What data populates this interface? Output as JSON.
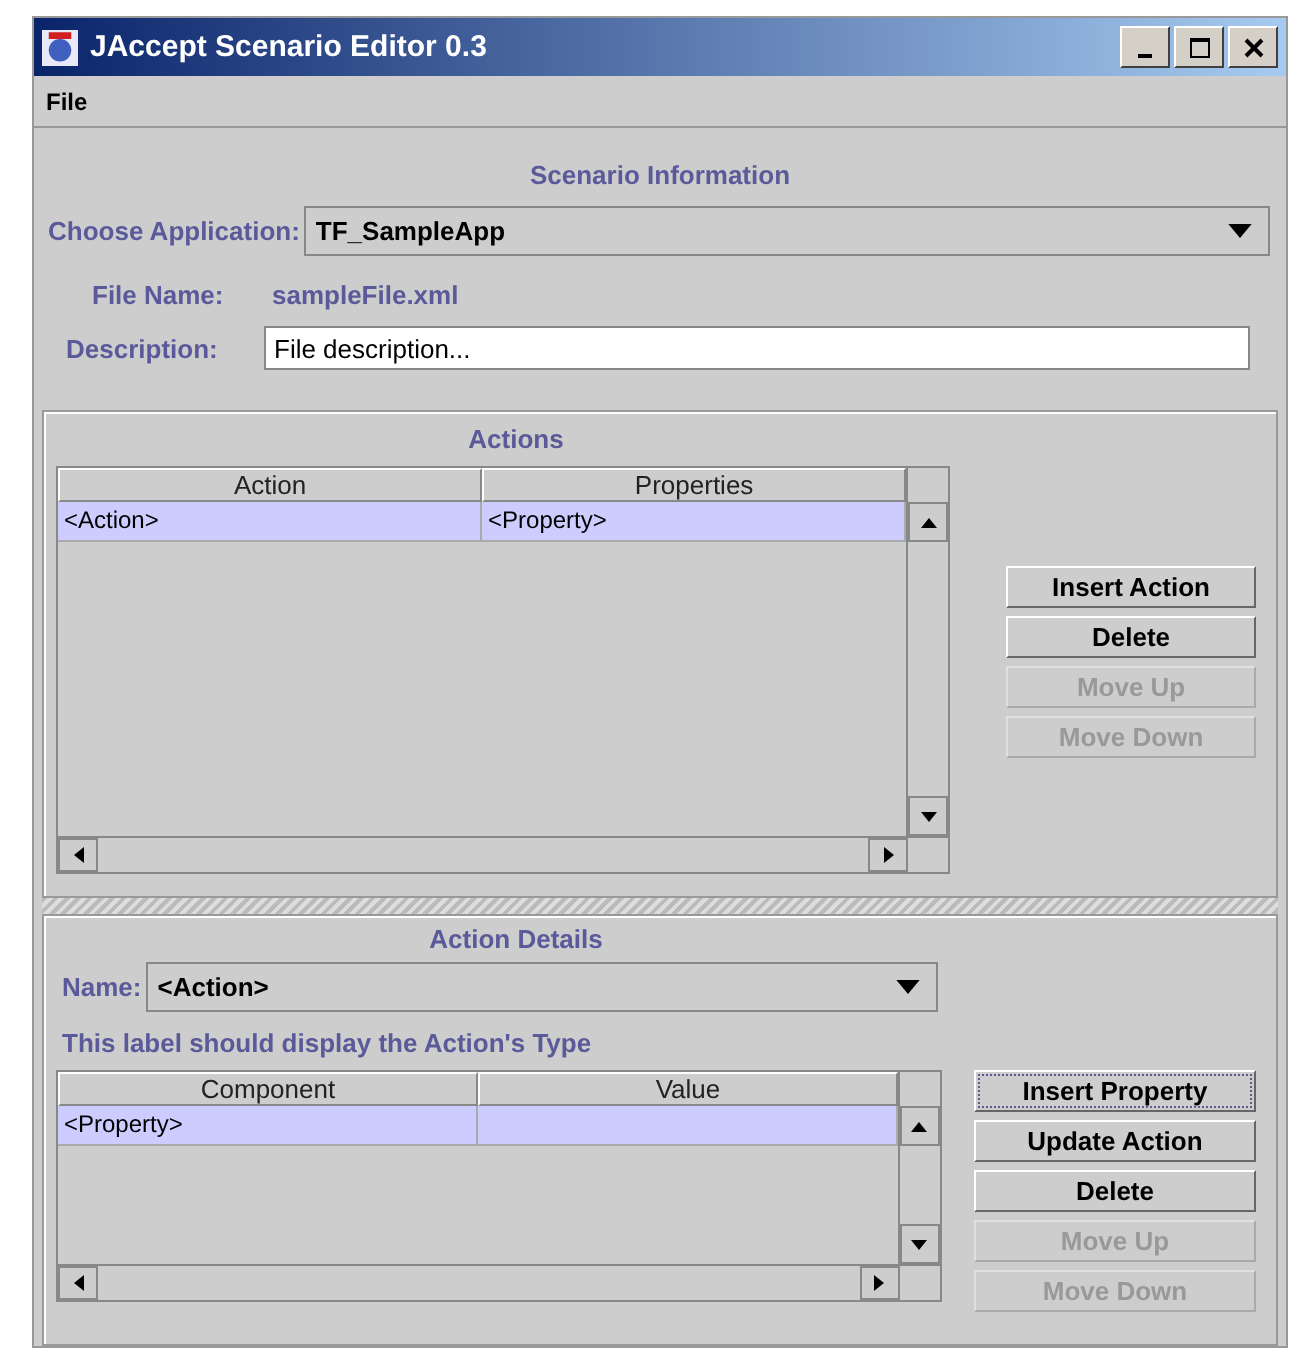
{
  "window": {
    "title": "JAccept Scenario Editor 0.3"
  },
  "menu": [
    {
      "label": "File"
    }
  ],
  "scenario": {
    "heading": "Scenario Information",
    "application_label": "Choose Application:",
    "application": "TF_SampleApp",
    "file_name_label": "File Name:",
    "file_name": "sampleFile.xml",
    "description_label": "Description:",
    "description": "File description..."
  },
  "actions": {
    "heading": "Actions",
    "columns": [
      "Action",
      "Properties"
    ],
    "rows": [
      {
        "cells": [
          "<Action>",
          "<Property>"
        ],
        "selected": true
      }
    ],
    "buttons": [
      {
        "label": "Insert Action",
        "disabled": false,
        "focused": false
      },
      {
        "label": "Delete",
        "disabled": false,
        "focused": false
      },
      {
        "label": "Move Up",
        "disabled": true,
        "focused": false
      },
      {
        "label": "Move Down",
        "disabled": true,
        "focused": false
      }
    ]
  },
  "details": {
    "heading": "Action Details",
    "name_label": "Name:",
    "name": "<Action>",
    "type_label": "This label should display the Action's Type",
    "columns": [
      "Component",
      "Value"
    ],
    "rows": [
      {
        "cells": [
          "<Property>",
          ""
        ],
        "selected": true
      }
    ],
    "buttons": [
      {
        "label": "Insert Property",
        "disabled": false,
        "focused": true
      },
      {
        "label": "Update Action",
        "disabled": false,
        "focused": false
      },
      {
        "label": "Delete",
        "disabled": false,
        "focused": false
      },
      {
        "label": "Move Up",
        "disabled": true,
        "focused": false
      },
      {
        "label": "Move Down",
        "disabled": true,
        "focused": false
      }
    ]
  }
}
